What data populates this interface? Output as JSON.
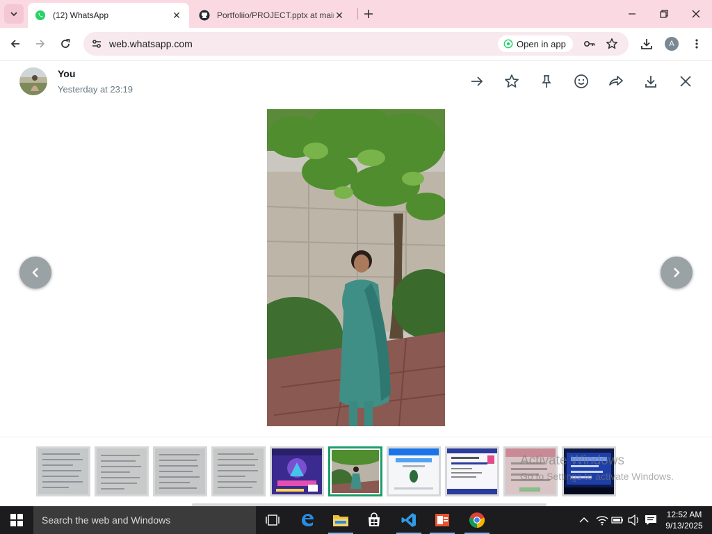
{
  "browser": {
    "tabs": [
      {
        "title": "(12) WhatsApp",
        "active": true,
        "icon": "whatsapp-icon"
      },
      {
        "title": "Portfoliio/PROJECT.pptx at main",
        "active": false,
        "icon": "github-icon"
      }
    ],
    "url": "web.whatsapp.com",
    "open_in_app_label": "Open in app",
    "profile_initial": "A",
    "colors": {
      "tabstrip": "#fad9e2",
      "omnibox": "#f7e9ee"
    }
  },
  "viewer": {
    "sender_name": "You",
    "timestamp": "Yesterday at 23:19",
    "actions": [
      "forward-arrow-icon",
      "star-icon",
      "pin-icon",
      "emoji-icon",
      "share-forward-icon",
      "download-icon",
      "close-icon"
    ],
    "thumbnails": [
      {
        "kind": "handwritten-notes"
      },
      {
        "kind": "handwritten-notes"
      },
      {
        "kind": "handwritten-notes"
      },
      {
        "kind": "handwritten-notes"
      },
      {
        "kind": "purple-event-poster"
      },
      {
        "kind": "photo-girl-tree",
        "selected": true
      },
      {
        "kind": "webpage-screenshot-blue"
      },
      {
        "kind": "document-screenshot"
      },
      {
        "kind": "pink-notes"
      },
      {
        "kind": "blue-screen-photo"
      }
    ],
    "accent_color": "#1a9c6b"
  },
  "watermark": {
    "line1": "Activate Windows",
    "line2": "Go to Settings to activate Windows."
  },
  "taskbar": {
    "search_placeholder": "Search the web and Windows",
    "apps": [
      "task-view-icon",
      "edge-icon",
      "file-explorer-icon",
      "store-icon",
      "vscode-icon",
      "office-icon",
      "chrome-icon"
    ],
    "time": "12:52 AM",
    "date": "9/13/2025"
  }
}
